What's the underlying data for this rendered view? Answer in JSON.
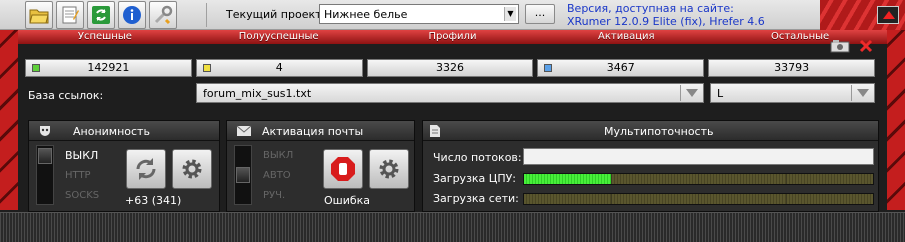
{
  "toolbar": {
    "project_label": "Текущий проект:",
    "project_value": "Нижнее белье",
    "browse_label": "...",
    "version_line1": "Версия, доступная на сайте:",
    "version_line2": "XRumer 12.0.9 Elite (fix), Hrefer 4.6"
  },
  "tabs": [
    "Успешные",
    "Полууспешные",
    "Профили",
    "Активация",
    "Остальные"
  ],
  "counters": [
    {
      "value": "142921",
      "dot_color": "#5fd03a"
    },
    {
      "value": "4",
      "dot_color": "#f0e040"
    },
    {
      "value": "3326",
      "dot_color": ""
    },
    {
      "value": "3467",
      "dot_color": "#5aa0e8"
    },
    {
      "value": "33793",
      "dot_color": ""
    }
  ],
  "links": {
    "label": "База ссылок:",
    "file": "forum_mix_sus1.txt",
    "mode": "L"
  },
  "anonymity": {
    "title": "Анонимность",
    "options": [
      "ВЫКЛ",
      "HTTP",
      "SOCKS"
    ],
    "count": "+63 (341)"
  },
  "activation": {
    "title": "Активация почты",
    "options": [
      "ВЫКЛ",
      "АВТО",
      "РУЧ."
    ],
    "status": "Ошибка"
  },
  "multithread": {
    "title": "Мультипоточность",
    "threads_label": "Число потоков:",
    "cpu_label": "Загрузка ЦПУ:",
    "net_label": "Загрузка сети:",
    "cpu_level": 0.25,
    "net_level": 0
  }
}
